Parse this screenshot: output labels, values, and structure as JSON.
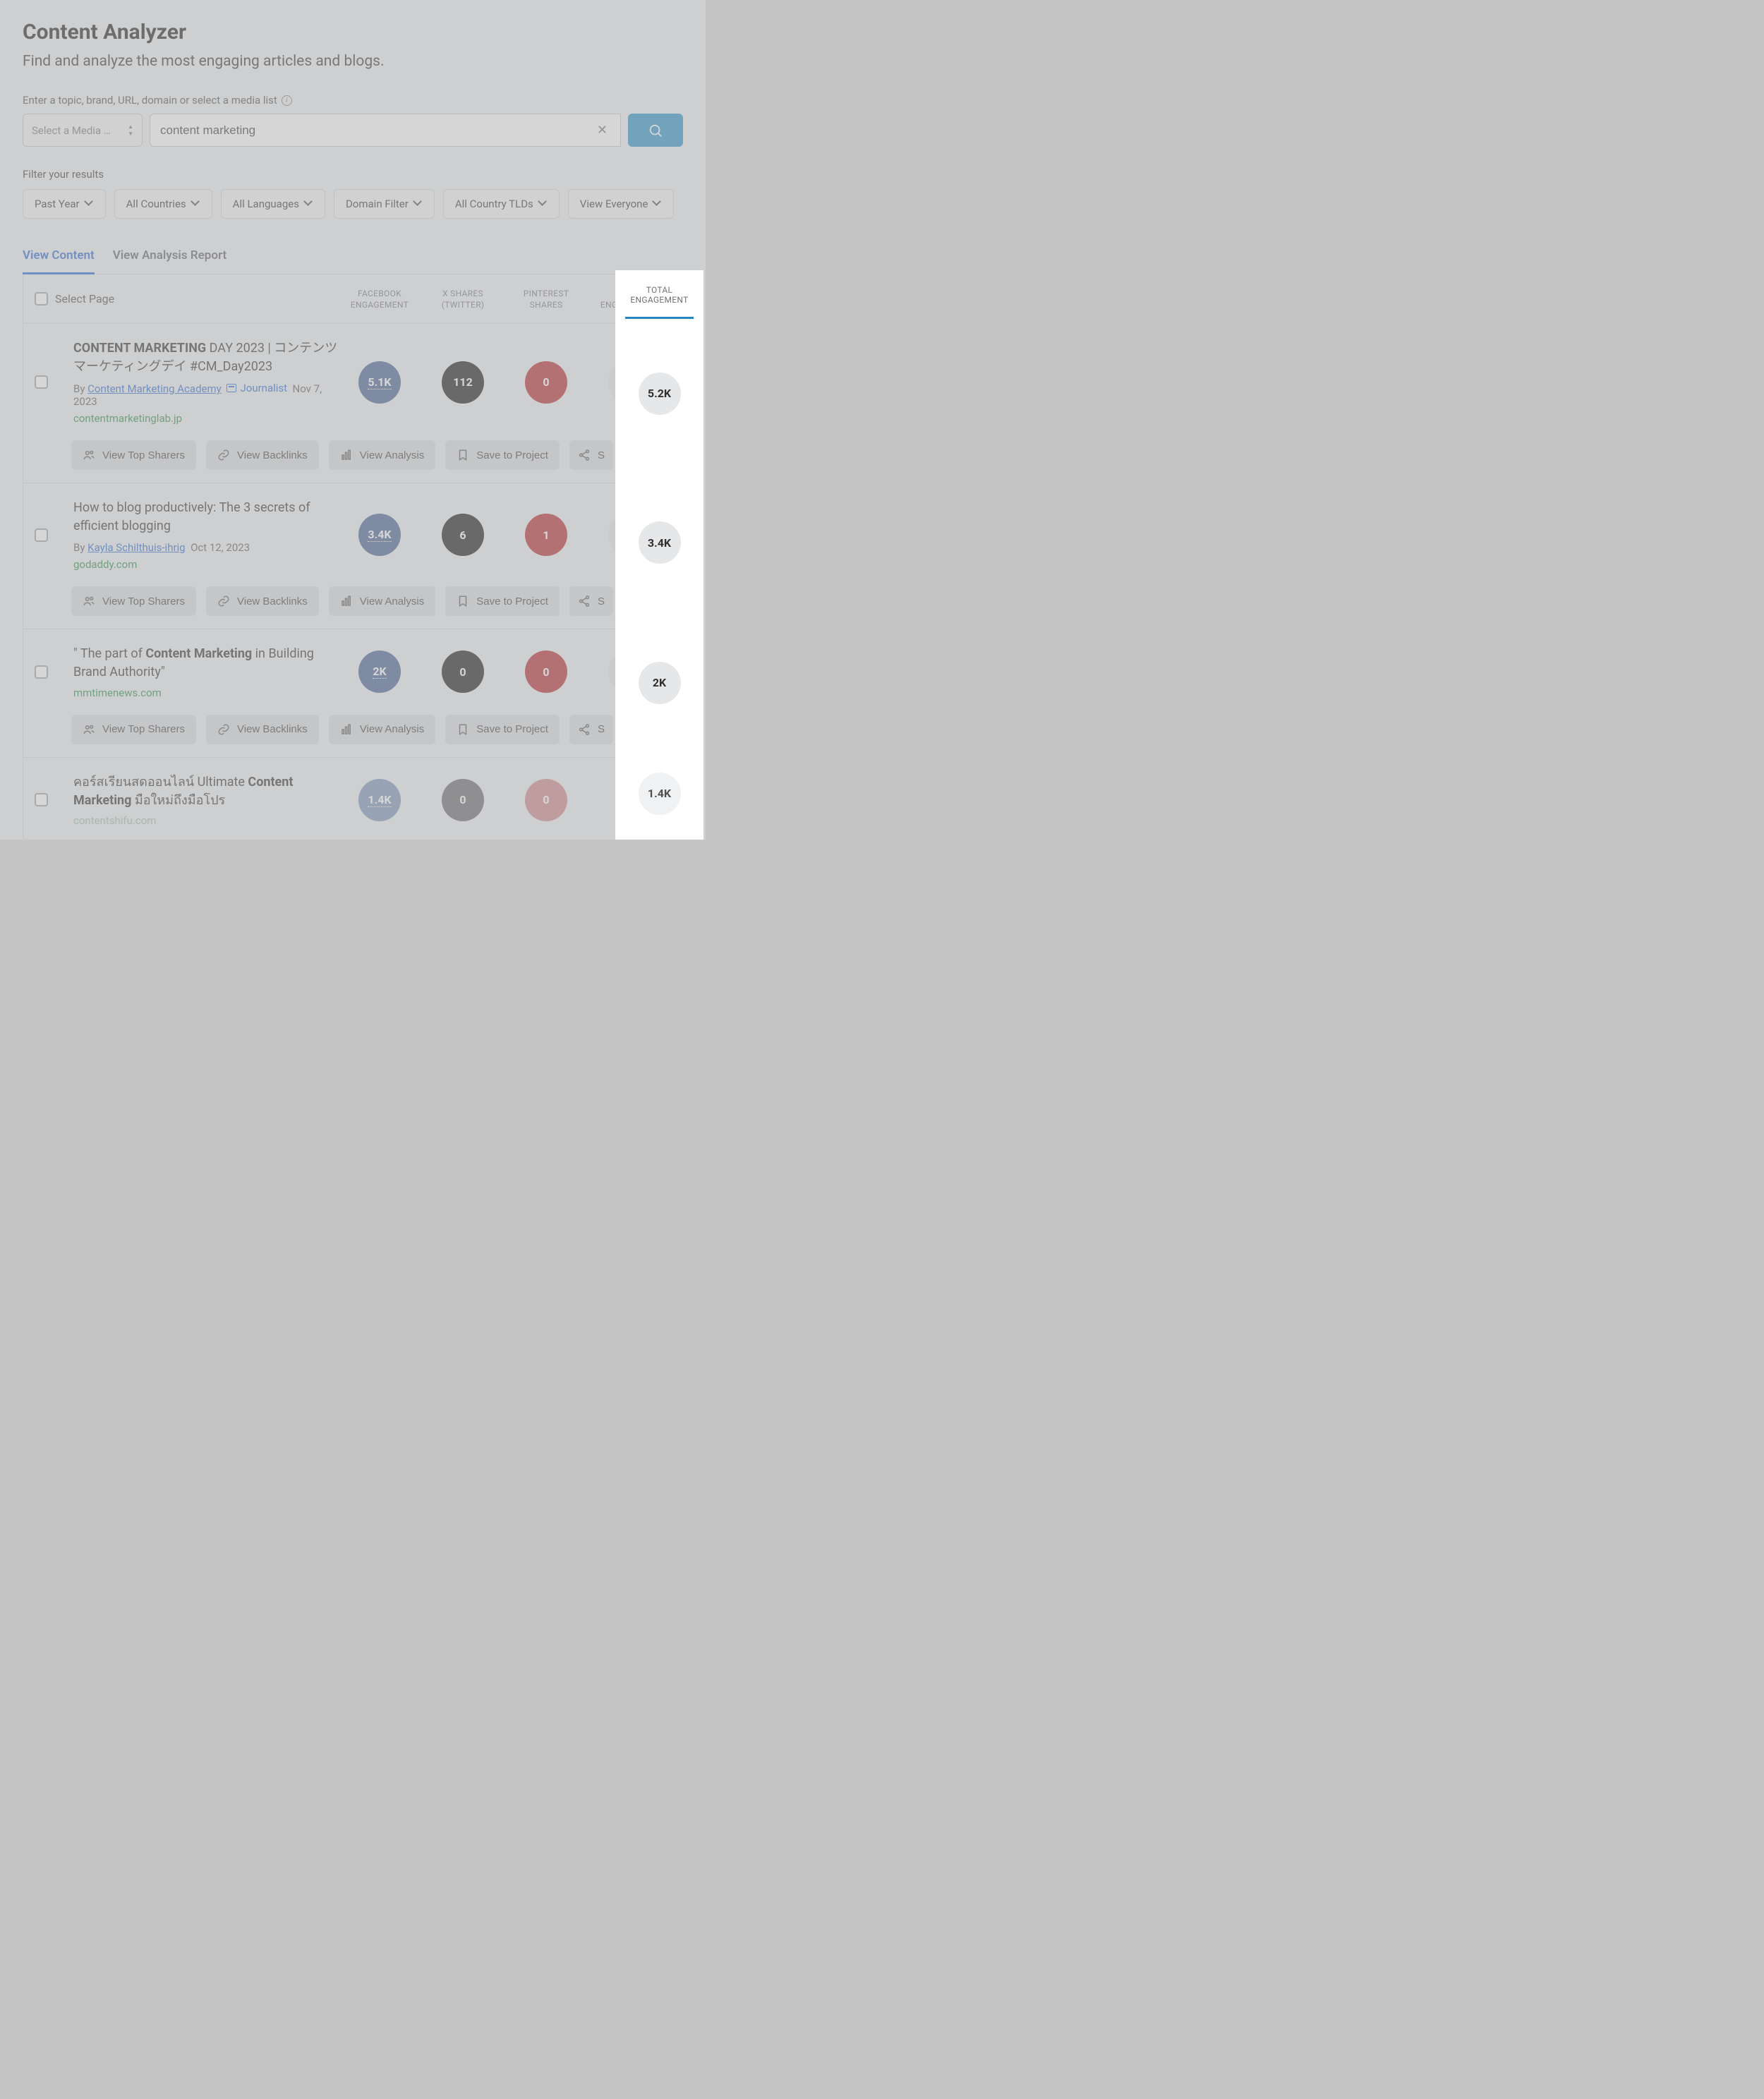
{
  "page": {
    "title": "Content Analyzer",
    "subtitle": "Find and analyze the most engaging articles and blogs."
  },
  "search": {
    "label": "Enter a topic, brand, URL, domain or select a media list",
    "media_select_placeholder": "Select a Media …",
    "input_value": "content marketing"
  },
  "filters": {
    "label": "Filter your results",
    "items": [
      {
        "label": "Past Year"
      },
      {
        "label": "All Countries"
      },
      {
        "label": "All Languages"
      },
      {
        "label": "Domain Filter"
      },
      {
        "label": "All Country TLDs"
      },
      {
        "label": "View Everyone"
      }
    ]
  },
  "tabs": {
    "view_content": "View Content",
    "view_analysis": "View Analysis Report"
  },
  "columns": {
    "select_page": "Select Page",
    "facebook_l1": "FACEBOOK",
    "facebook_l2": "ENGAGEMENT",
    "x_l1": "X SHARES",
    "x_l2": "(TWITTER)",
    "pin_l1": "PINTEREST",
    "pin_l2": "SHARES",
    "total_l1": "TOTAL",
    "total_l2": "ENGAGEMENT"
  },
  "actions": {
    "top_sharers": "View Top Sharers",
    "backlinks": "View Backlinks",
    "analysis": "View Analysis",
    "save": "Save to Project",
    "share_cut": "S"
  },
  "results": [
    {
      "title_bold": "CONTENT MARKETING",
      "title_rest": " DAY 2023 | コンテンツマーケティングデイ #CM_Day2023",
      "by_prefix": "By ",
      "author": "Content Marketing Academy",
      "show_journalist": true,
      "journalist_label": "Journalist",
      "date": "Nov 7, 2023",
      "domain": "contentmarketinglab.jp",
      "fb": "5.1K",
      "x": "112",
      "pin": "0",
      "total": "5.2K"
    },
    {
      "title_plain": "How to blog productively: The 3 secrets of efficient blogging",
      "by_prefix": "By ",
      "author": "Kayla Schilthuis-ihrig",
      "show_journalist": false,
      "date": "Oct 12, 2023",
      "domain": "godaddy.com",
      "fb": "3.4K",
      "x": "6",
      "pin": "1",
      "total": "3.4K"
    },
    {
      "title_pre": "\" The part of ",
      "title_bold": "Content Marketing",
      "title_post": " in Building Brand Authority\"",
      "domain": "mmtimenews.com",
      "fb": "2K",
      "x": "0",
      "pin": "0",
      "total": "2K"
    },
    {
      "title_pre": "คอร์สเรียนสดออนไลน์ Ultimate ",
      "title_bold": "Content Marketing",
      "title_post2": " มือใหม่ถึงมือโปร",
      "domain": "contentshifu.com",
      "fb": "1.4K",
      "x": "0",
      "pin": "0",
      "total": "1.4K"
    }
  ]
}
